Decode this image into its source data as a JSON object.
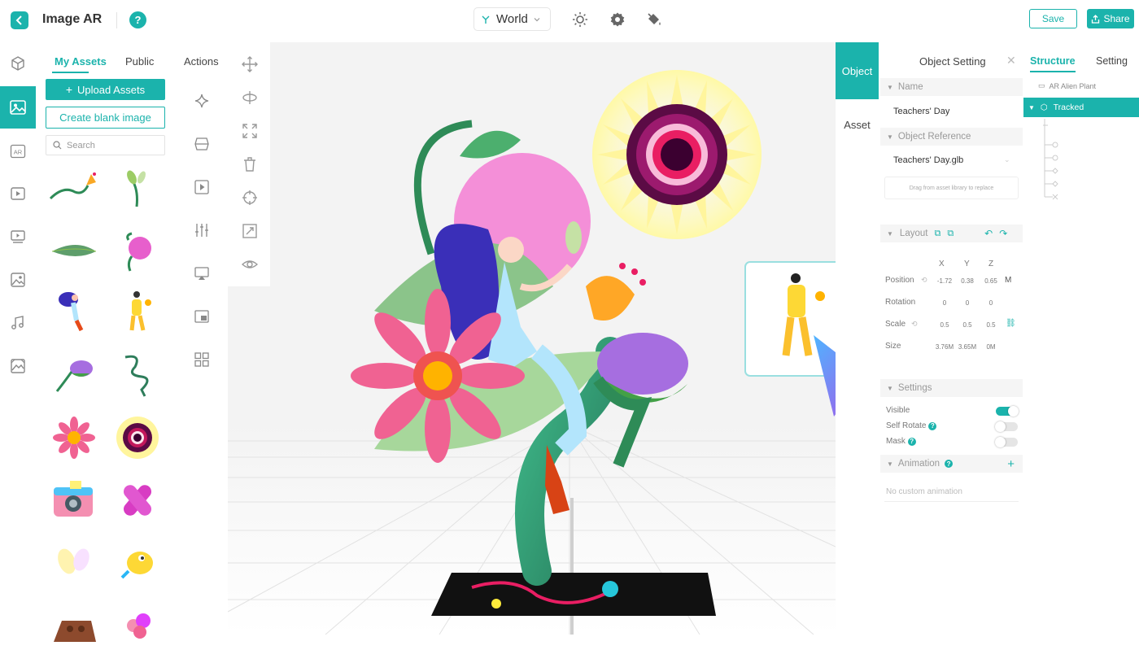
{
  "header": {
    "app_title": "Image AR",
    "help_glyph": "?",
    "world_label": "World",
    "save_label": "Save",
    "share_label": "Share",
    "accent_color": "#1bb3ac",
    "icons": [
      "back-icon",
      "help-icon",
      "world-icon",
      "sun-icon",
      "gear-icon",
      "paint-bucket-icon",
      "share-icon"
    ]
  },
  "left_rail": {
    "items": [
      "cube-icon",
      "image-icon",
      "ar-icon",
      "video-icon",
      "slideshow-icon",
      "picture-icon",
      "music-icon",
      "gallery-icon"
    ],
    "active": "image-icon",
    "ar_text": "AR"
  },
  "assets_panel": {
    "tabs": [
      "My Assets",
      "Public",
      "Actions"
    ],
    "active_tab": "My Assets",
    "upload_label": "Upload Assets",
    "create_label": "Create blank image",
    "search_placeholder": "Search",
    "thumbnails": [
      "flower-stem",
      "sprout",
      "leaf",
      "pink-bulb",
      "dancing-girl",
      "yellow-boy",
      "purple-bulb",
      "green-vine",
      "pink-flower",
      "sun-ring",
      "camera",
      "pink-cross",
      "butterfly",
      "yellow-bird",
      "chocolate",
      "balloons"
    ]
  },
  "actions_column": {
    "icons": [
      "sparkle-icon",
      "box-icon",
      "play-icon",
      "sliders-icon",
      "presentation-icon",
      "picture-in-picture-icon",
      "grid-icon"
    ]
  },
  "tool_strip": {
    "icons": [
      "move-icon",
      "rotate-icon",
      "scale-icon",
      "trash-icon",
      "target-icon",
      "fit-icon",
      "eye-icon"
    ]
  },
  "object_panel": {
    "tabs": [
      "Object",
      "Asset"
    ],
    "active_tab": "Object",
    "title": "Object Setting",
    "name_header": "Name",
    "name_value": "Teachers' Day",
    "ref_header": "Object Reference",
    "ref_value": "Teachers' Day.glb",
    "drop_hint": "Drag from asset library to replace",
    "layout_header": "Layout",
    "axis_labels": [
      "X",
      "Y",
      "Z"
    ],
    "position_label": "Position",
    "position": [
      "-1.72",
      "0.38",
      "0.65"
    ],
    "position_unit": "M",
    "rotation_label": "Rotation",
    "rotation": [
      "0",
      "0",
      "0"
    ],
    "scale_label": "Scale",
    "scale": [
      "0.5",
      "0.5",
      "0.5"
    ],
    "size_label": "Size",
    "size": [
      "3.76M",
      "3.65M",
      "0M"
    ],
    "settings_header": "Settings",
    "visible_label": "Visible",
    "visible": true,
    "self_rotate_label": "Self Rotate",
    "self_rotate": false,
    "mask_label": "Mask",
    "mask": false,
    "animation_header": "Animation",
    "no_animation": "No custom animation"
  },
  "structure_panel": {
    "tabs": [
      "Structure",
      "Setting"
    ],
    "active_tab": "Structure",
    "root_label": "AR Alien Plant",
    "tracked_label": "Tracked"
  }
}
